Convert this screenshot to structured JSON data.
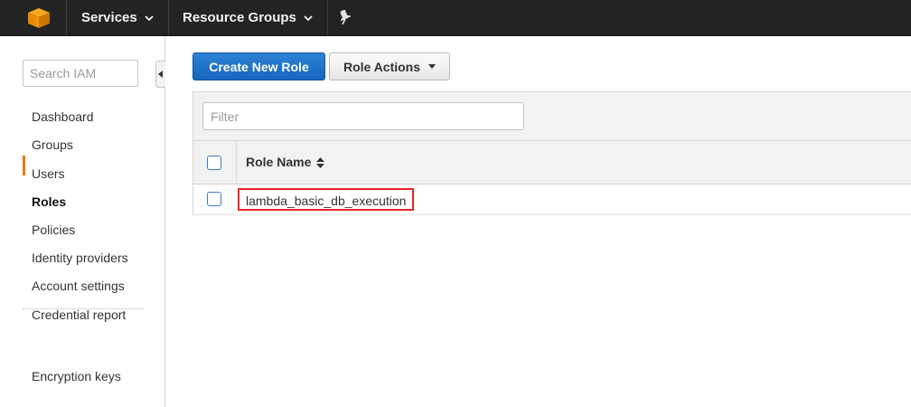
{
  "topnav": {
    "logo_icon": "aws-cube-icon",
    "services_label": "Services",
    "resource_groups_label": "Resource Groups",
    "pin_icon": "pin-icon"
  },
  "sidebar": {
    "search": {
      "placeholder": "Search IAM",
      "value": ""
    },
    "items": [
      {
        "label": "Dashboard"
      },
      {
        "label": "Groups"
      },
      {
        "label": "Users"
      },
      {
        "label": "Roles",
        "active": true
      },
      {
        "label": "Policies"
      },
      {
        "label": "Identity providers"
      },
      {
        "label": "Account settings"
      },
      {
        "label": "Credential report"
      }
    ],
    "secondary_items": [
      {
        "label": "Encryption keys"
      }
    ]
  },
  "toolbar": {
    "create_label": "Create New Role",
    "actions_label": "Role Actions"
  },
  "filter": {
    "placeholder": "Filter",
    "value": ""
  },
  "table": {
    "columns": [
      {
        "label": "Role Name",
        "sortable": true
      }
    ],
    "rows": [
      {
        "role_name": "lambda_basic_db_execution",
        "highlighted": true
      }
    ]
  },
  "colors": {
    "topnav_bg": "#232323",
    "primary_button": "#1f74c9",
    "active_accent": "#e47911",
    "highlight_box": "#e8262d",
    "logo": "#f29100"
  }
}
